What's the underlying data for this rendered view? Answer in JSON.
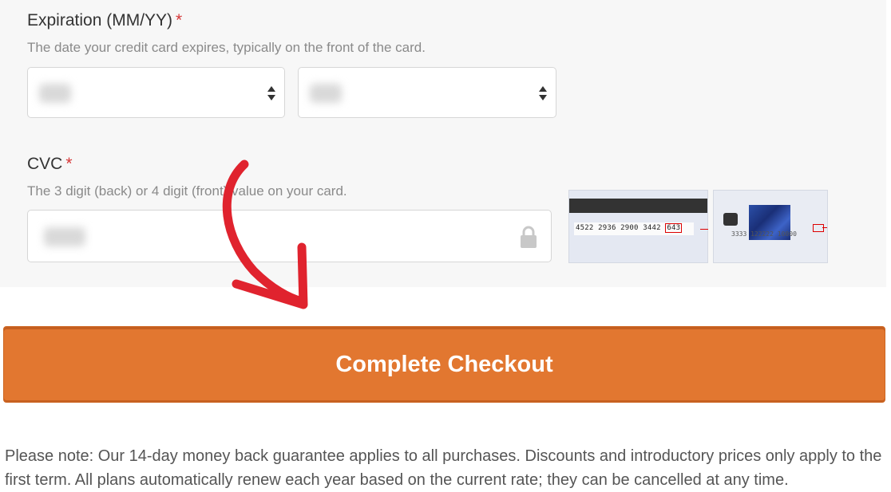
{
  "expiration": {
    "label": "Expiration (MM/YY)",
    "required_mark": "*",
    "description": "The date your credit card expires, typically on the front of the card.",
    "month_select": {
      "value": ""
    },
    "year_select": {
      "value": ""
    }
  },
  "cvc": {
    "label": "CVC",
    "required_mark": "*",
    "description": "The 3 digit (back) or 4 digit (front) value on your card.",
    "input": {
      "value": ""
    },
    "card_back_number": "4522 2936 2900 3442",
    "card_back_cvc": "643",
    "card_front_number": "3333 122222 10000"
  },
  "checkout": {
    "button_label": "Complete Checkout"
  },
  "note": {
    "text": "Please note: Our 14-day money back guarantee applies to all purchases. Discounts and introductory prices only apply to the first term. All plans automatically renew each year based on the current rate; they can be cancelled at any time."
  },
  "colors": {
    "button": "#e27730",
    "required": "#d63637",
    "arrow": "#e0232e",
    "panel": "#f7f7f7"
  },
  "icons": {
    "lock": "lock-icon",
    "select_arrows": "updown-arrows-icon",
    "annotation": "curved-arrow-icon"
  }
}
